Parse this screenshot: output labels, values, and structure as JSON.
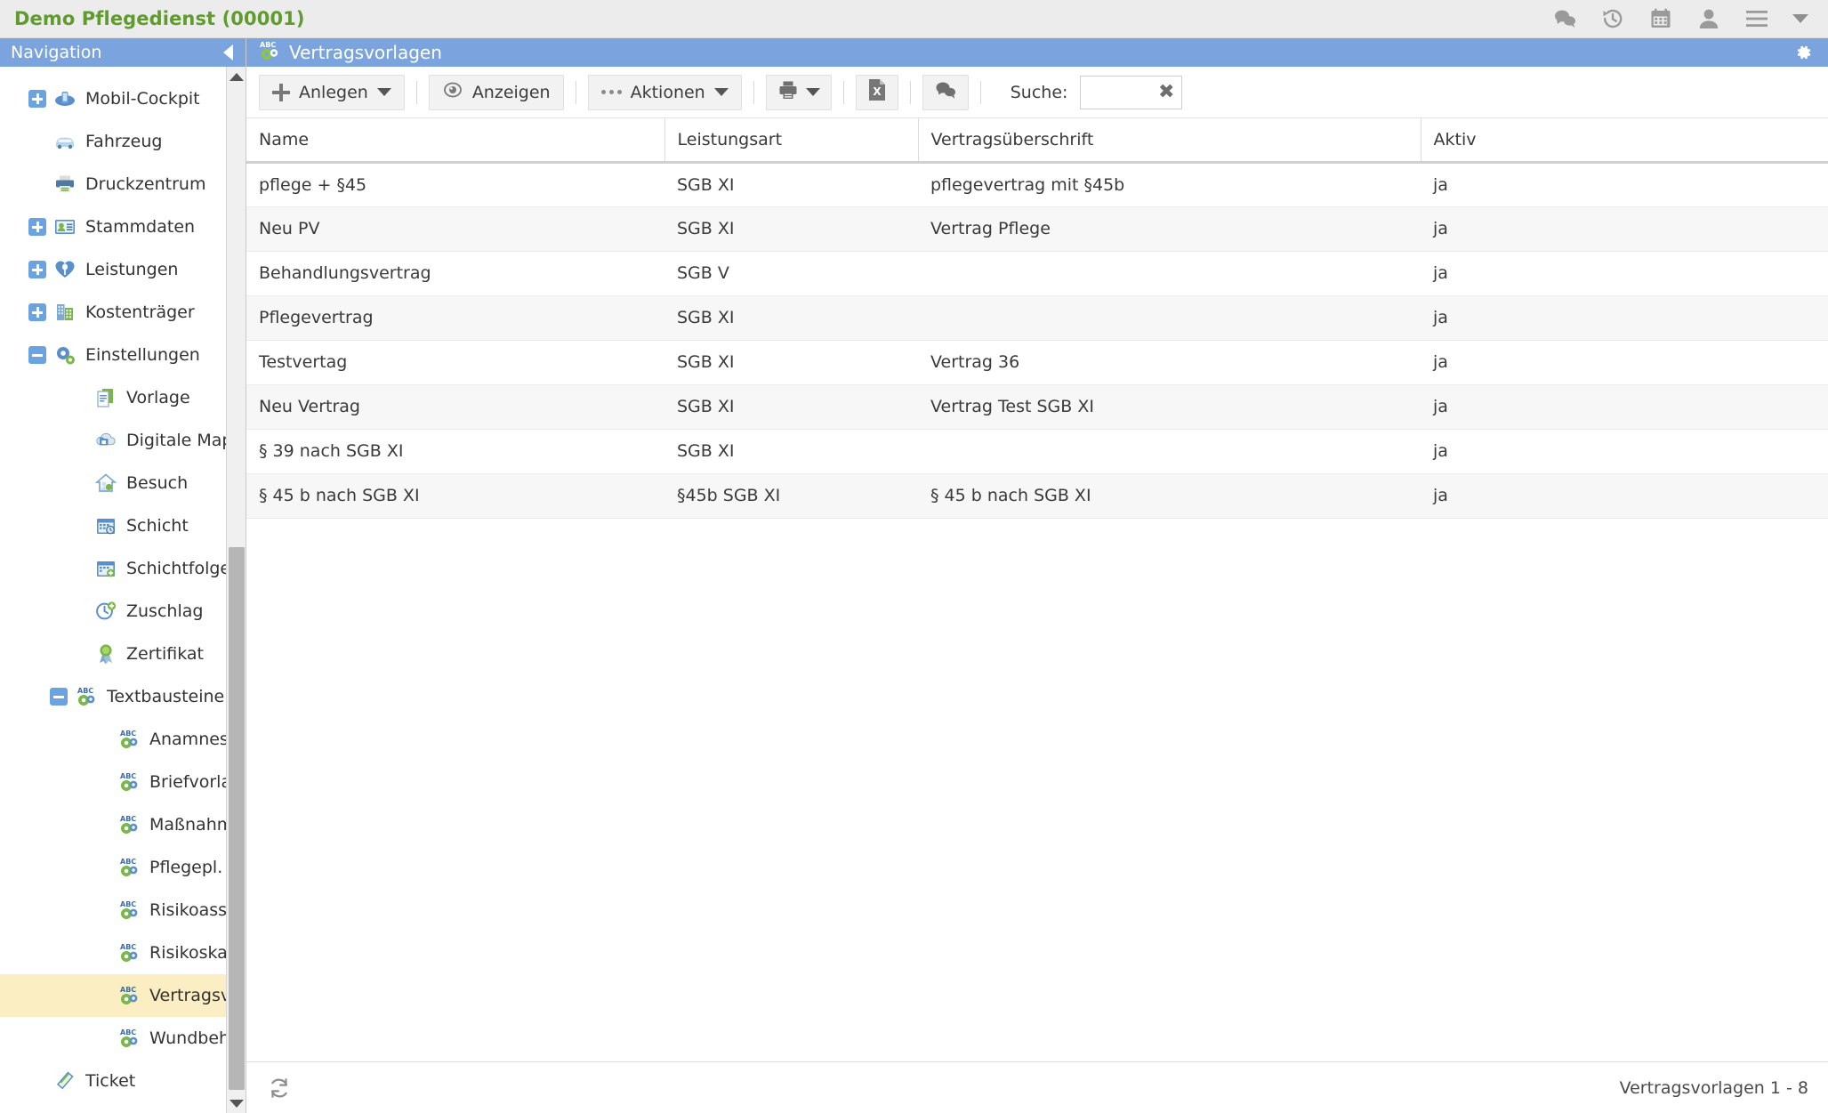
{
  "topbar": {
    "app_title": "Demo Pflegedienst (00001)",
    "title_color": "#5f9b2d",
    "icons": [
      {
        "name": "chat-icon",
        "label": "Chat"
      },
      {
        "name": "history-icon",
        "label": "Verlauf"
      },
      {
        "name": "calendar-icon",
        "label": "Kalender"
      },
      {
        "name": "user-icon",
        "label": "Benutzer"
      },
      {
        "name": "hamburger-menu-icon",
        "label": "Menü"
      },
      {
        "name": "menu-dropdown-caret-icon",
        "label": "Mehr"
      }
    ]
  },
  "sidebar": {
    "header_title": "Navigation",
    "header_color": "#7ba4de",
    "collapse_icon": "collapse-left-icon",
    "selected_item": "Vertragsvorl.",
    "items": [
      {
        "label": "Mobil-Cockpit",
        "level": 0,
        "expander": "plus",
        "icon": "mobile-cockpit-icon"
      },
      {
        "label": "Fahrzeug",
        "level": 0,
        "expander": "none",
        "icon": "car-icon"
      },
      {
        "label": "Druckzentrum",
        "level": 0,
        "expander": "none",
        "icon": "printer-icon"
      },
      {
        "label": "Stammdaten",
        "level": 0,
        "expander": "plus",
        "icon": "id-card-icon"
      },
      {
        "label": "Leistungen",
        "level": 0,
        "expander": "plus",
        "icon": "heart-icon"
      },
      {
        "label": "Kostenträger",
        "level": 0,
        "expander": "plus",
        "icon": "building-icon"
      },
      {
        "label": "Einstellungen",
        "level": 0,
        "expander": "minus",
        "icon": "gear-icon"
      },
      {
        "label": "Vorlage",
        "level": 1,
        "expander": "none",
        "icon": "document-copy-icon"
      },
      {
        "label": "Digitale Mappe Designer",
        "level": 1,
        "expander": "none",
        "icon": "cloud-folder-icon"
      },
      {
        "label": "Besuch",
        "level": 1,
        "expander": "none",
        "icon": "house-visit-icon"
      },
      {
        "label": "Schicht",
        "level": 1,
        "expander": "none",
        "icon": "calendar-clock-icon"
      },
      {
        "label": "Schichtfolge",
        "level": 1,
        "expander": "none",
        "icon": "calendar-add-icon"
      },
      {
        "label": "Zuschlag",
        "level": 1,
        "expander": "none",
        "icon": "clock-add-icon"
      },
      {
        "label": "Zertifikat",
        "level": 1,
        "expander": "none",
        "icon": "award-icon"
      },
      {
        "label": "Textbausteine",
        "level": 1,
        "expander": "minus",
        "icon": "abc-gear-icon"
      },
      {
        "label": "Anamnese",
        "level": 2,
        "expander": "none",
        "icon": "abc-gear-icon"
      },
      {
        "label": "Briefvorlage",
        "level": 2,
        "expander": "none",
        "icon": "abc-gear-icon"
      },
      {
        "label": "Maßnahme",
        "level": 2,
        "expander": "none",
        "icon": "abc-gear-icon"
      },
      {
        "label": "Pflegepl.",
        "level": 2,
        "expander": "none",
        "icon": "abc-gear-icon"
      },
      {
        "label": "Risikoasses.",
        "level": 2,
        "expander": "none",
        "icon": "abc-gear-icon"
      },
      {
        "label": "Risikoskale",
        "level": 2,
        "expander": "none",
        "icon": "abc-gear-icon"
      },
      {
        "label": "Vertragsvorl.",
        "level": 2,
        "expander": "none",
        "icon": "abc-gear-icon",
        "selected": true
      },
      {
        "label": "Wundbehand.",
        "level": 2,
        "expander": "none",
        "icon": "abc-gear-icon"
      },
      {
        "label": "Ticket",
        "level": 0,
        "expander": "none",
        "icon": "ticket-icon"
      }
    ]
  },
  "main": {
    "header": {
      "title": "Vertragsvorlagen",
      "icon": "abc-gear-icon",
      "settings_icon": "gear-icon"
    },
    "toolbar": {
      "create_label": "Anlegen",
      "view_label": "Anzeigen",
      "actions_label": "Aktionen",
      "print_icon": "printer-icon",
      "excel_icon": "excel-export-icon",
      "chat_icon": "chat-icon",
      "search_label": "Suche:",
      "search_value": "",
      "search_placeholder": "",
      "search_clear_icon": "clear-x-icon"
    },
    "table": {
      "columns": [
        "Name",
        "Leistungsart",
        "Vertragsüberschrift",
        "Aktiv"
      ],
      "rows": [
        {
          "name": "pflege + §45",
          "leistungsart": "SGB XI",
          "ueberschrift": "pflegevertrag mit §45b",
          "aktiv": "ja"
        },
        {
          "name": "Neu PV",
          "leistungsart": "SGB XI",
          "ueberschrift": "Vertrag Pflege",
          "aktiv": "ja"
        },
        {
          "name": "Behandlungsvertrag",
          "leistungsart": "SGB V",
          "ueberschrift": "",
          "aktiv": "ja"
        },
        {
          "name": "Pflegevertrag",
          "leistungsart": "SGB XI",
          "ueberschrift": "",
          "aktiv": "ja"
        },
        {
          "name": "Testvertag",
          "leistungsart": "SGB XI",
          "ueberschrift": "Vertrag 36",
          "aktiv": "ja"
        },
        {
          "name": "Neu Vertrag",
          "leistungsart": "SGB XI",
          "ueberschrift": "Vertrag Test SGB XI",
          "aktiv": "ja"
        },
        {
          "name": "§ 39 nach SGB XI",
          "leistungsart": "SGB XI",
          "ueberschrift": "",
          "aktiv": "ja"
        },
        {
          "name": "§ 45 b nach SGB XI",
          "leistungsart": "§45b SGB XI",
          "ueberschrift": "§ 45 b nach SGB XI",
          "aktiv": "ja"
        }
      ]
    },
    "footer": {
      "refresh_icon": "refresh-icon",
      "count_text": "Vertragsvorlagen 1 - 8"
    }
  }
}
